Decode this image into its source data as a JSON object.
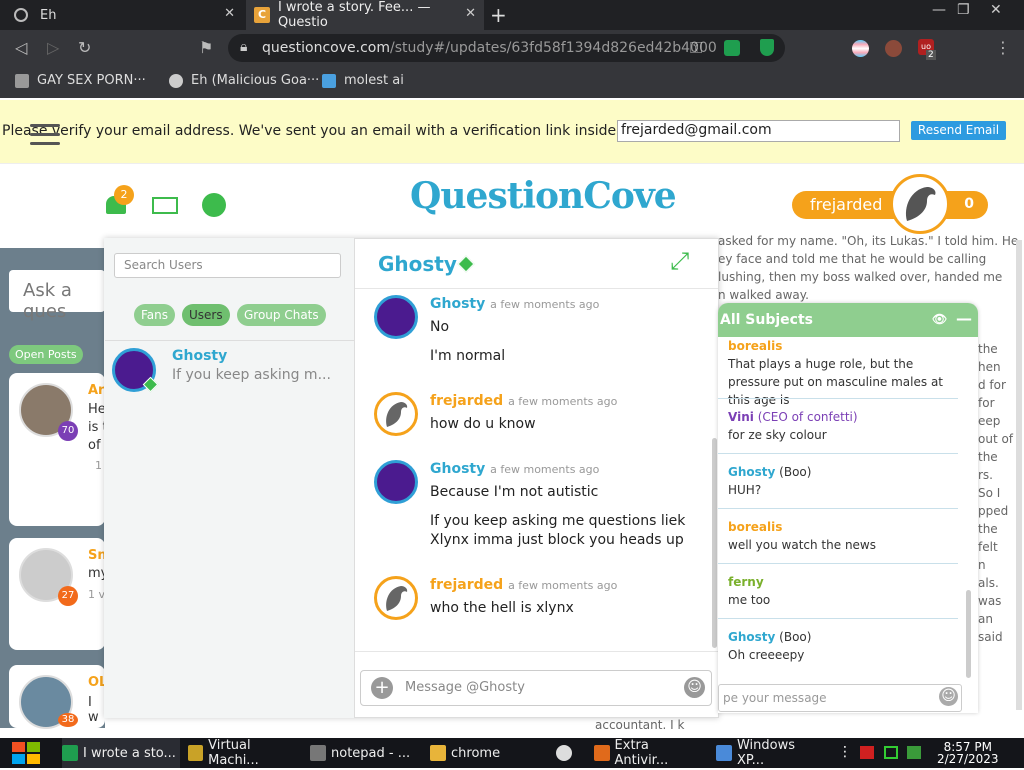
{
  "browser": {
    "tabs": [
      {
        "title": "Eh"
      },
      {
        "title": "I wrote a story. Fee... — Questio"
      }
    ],
    "url_host": "questioncove.com",
    "url_path": "/study#/updates/63fd58f1394d826ed42b4000",
    "bookmarks": [
      {
        "label": "GAY SEX PORN···"
      },
      {
        "label": "Eh (Malicious Goa···"
      },
      {
        "label": "molest ai"
      }
    ],
    "ext_badge": "2"
  },
  "verify_bar": {
    "message": "Please verify your email address. We've sent you an email with a verification link inside.",
    "email_value": "frejarded@gmail.com",
    "resend_label": "Resend Email"
  },
  "header": {
    "logo": "QuestionCove",
    "notif_count": "2",
    "username": "frejarded",
    "score": "0"
  },
  "feed": {
    "ask_placeholder": "Ask a ques",
    "open_posts_label": "Open Posts",
    "cards": [
      {
        "name": "Ari",
        "badge": "70",
        "text": "He\nis t\nof",
        "stat": "1"
      },
      {
        "name": "Sn",
        "badge": "27",
        "text": "my",
        "stat": "1 v"
      },
      {
        "name": "OL",
        "badge": "38",
        "text": "I w",
        "stat": ""
      }
    ]
  },
  "chat": {
    "search_placeholder": "Search Users",
    "filters": [
      "Fans",
      "Users",
      "Group Chats"
    ],
    "active_filter": "Users",
    "conversations": [
      {
        "name": "Ghosty",
        "preview": "If you keep asking m..."
      }
    ],
    "active_user": "Ghosty",
    "messages": [
      {
        "from": "Ghosty",
        "time": "a few moments ago",
        "lines": [
          "No",
          "I'm normal"
        ]
      },
      {
        "from": "frejarded",
        "time": "a few moments ago",
        "lines": [
          "how do u know"
        ]
      },
      {
        "from": "Ghosty",
        "time": "a few moments ago",
        "lines": [
          "Because I'm not autistic",
          "If you keep asking me questions liek Xlynx imma just block you heads up"
        ]
      },
      {
        "from": "frejarded",
        "time": "a few moments ago",
        "lines": [
          "who the hell is xlynx"
        ]
      }
    ],
    "composer_placeholder": "Message @Ghosty"
  },
  "background_text": {
    "top": [
      "asked for my name. \"Oh, its Lukas.\" I told him. He",
      "ey face and told me that he would be calling",
      "lushing, then my boss walked over, handed me",
      "n walked away."
    ],
    "right_edge": [
      "the",
      "hen",
      "d for",
      "",
      "for",
      "eep",
      "out of",
      "the",
      "",
      "rs.",
      "So I",
      "pped",
      "",
      "the",
      "felt",
      "",
      "n",
      "als.",
      "was",
      "an",
      "said"
    ],
    "bottom": "accountant. I k"
  },
  "subjects": {
    "title": "All Subjects",
    "items": [
      {
        "name": "borealis",
        "color": "#f5a21b",
        "tag": "",
        "text": "That plays a huge role, but the pressure put on masculine males at this age is"
      },
      {
        "name": "Vini",
        "color": "#7b3fb5",
        "tag": "(CEO of confetti)",
        "text": "for ze sky colour"
      },
      {
        "name": "Ghosty",
        "color": "#2fa7cf",
        "tag": "(Boo)",
        "text": "HUH?"
      },
      {
        "name": "borealis",
        "color": "#f5a21b",
        "tag": "",
        "text": "well you watch the news"
      },
      {
        "name": "ferny",
        "color": "#7ab02c",
        "tag": "",
        "text": "me too"
      },
      {
        "name": "Ghosty",
        "color": "#2fa7cf",
        "tag": "(Boo)",
        "text": "Oh creeeepy"
      }
    ],
    "input_placeholder": "pe your message"
  },
  "taskbar": {
    "items": [
      "I wrote a sto...",
      "Virtual Machi...",
      "notepad - ...",
      "chrome",
      "Extra Antivir...",
      "Windows XP..."
    ],
    "time": "8:57 PM",
    "date": "2/27/2023"
  }
}
